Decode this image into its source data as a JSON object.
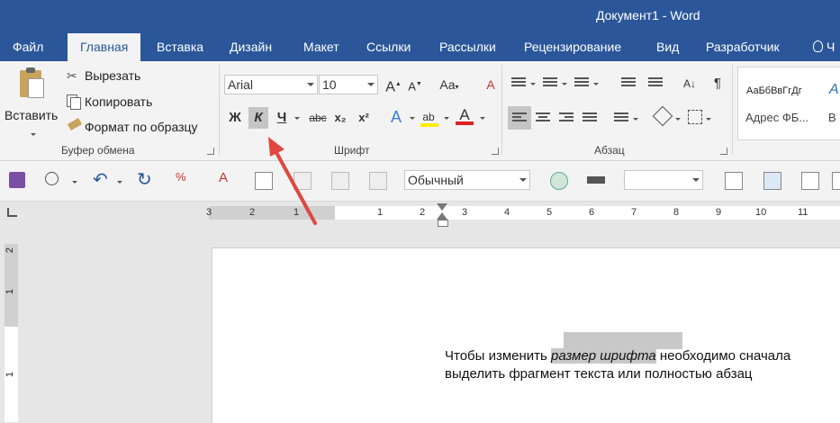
{
  "window": {
    "title": "Документ1 - Word"
  },
  "tabs": [
    "Файл",
    "Главная",
    "Вставка",
    "Дизайн",
    "Макет",
    "Ссылки",
    "Рассылки",
    "Рецензирование",
    "Вид",
    "Разработчик",
    "Ч"
  ],
  "ribbon": {
    "clipboard": {
      "paste_label": "Вставить",
      "cut_label": "Вырезать",
      "copy_label": "Копировать",
      "format_painter_label": "Формат по образцу",
      "group_label": "Буфер обмена"
    },
    "font": {
      "font_name": "Arial",
      "font_size": "10",
      "bold": "Ж",
      "italic": "К",
      "underline": "Ч",
      "strike": "abc",
      "subscript": "x₂",
      "superscript": "x²",
      "group_label": "Шрифт"
    },
    "paragraph": {
      "group_label": "Абзац"
    },
    "styles": {
      "sample1": "АаБбВвГгДг",
      "name1": "Адрес ФБ...",
      "sample2": "А",
      "name2": "В"
    }
  },
  "qat": {
    "style_value": "Обычный"
  },
  "ruler": {
    "labels": [
      "3",
      "2",
      "1",
      "1",
      "2",
      "3",
      "4",
      "5",
      "6",
      "7",
      "8",
      "9",
      "10",
      "11"
    ]
  },
  "vruler": {
    "labels": [
      "2",
      "1",
      "1"
    ]
  },
  "document": {
    "line1_before": "Чтобы изменить ",
    "line1_highlight": "размер шрифта",
    "line1_after": " необходимо сначала",
    "line2": "выделить фрагмент текста или полностью абзац"
  },
  "colors": {
    "titlebar": "#2b579a",
    "arrow": "#e0473f",
    "highlight": "#c8c8c8",
    "font_color": "#d22"
  }
}
